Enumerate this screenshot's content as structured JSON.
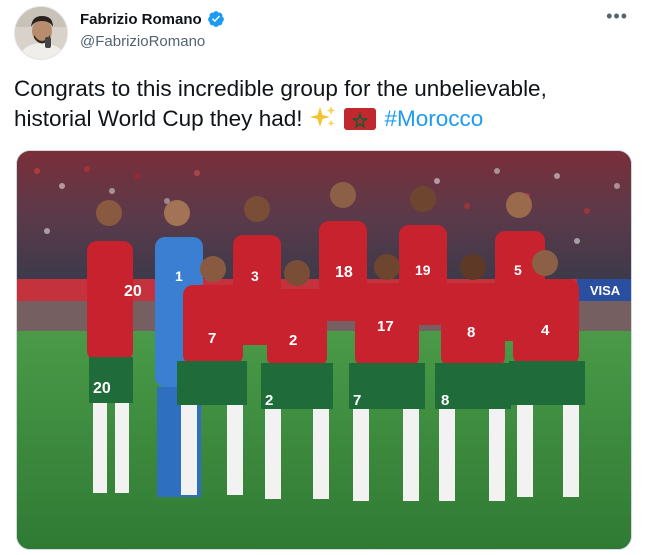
{
  "author": {
    "display_name": "Fabrizio Romano",
    "handle": "@FabrizioRomano",
    "verified": true,
    "avatar_icon": "profile-photo",
    "verified_icon": "verified-badge-icon"
  },
  "tweet": {
    "line1": "Congrats to this incredible group for the unbelievable,",
    "line2": "historial World Cup they had!",
    "emojis": [
      "sparkles-emoji",
      "morocco-flag-emoji"
    ],
    "hashtag": "#Morocco"
  },
  "media": {
    "type": "photo",
    "banner_text": "VISA",
    "jersey_numbers_back_row": [
      "20",
      "1",
      "3",
      "18",
      "19",
      "5"
    ],
    "jersey_numbers_front_row": [
      "7",
      "2",
      "17",
      "8",
      "4"
    ],
    "shorts_numbers": [
      "20",
      "2",
      "7",
      "8"
    ]
  },
  "colors": {
    "accent": "#1d9bf0",
    "text_primary": "#0f1419",
    "text_secondary": "#536471",
    "kit_red": "#c8222e",
    "kit_green": "#1f6b3a",
    "pitch": "#3d8a3f",
    "keeper_blue": "#3a7fd1"
  },
  "more_icon": "ellipsis-icon"
}
